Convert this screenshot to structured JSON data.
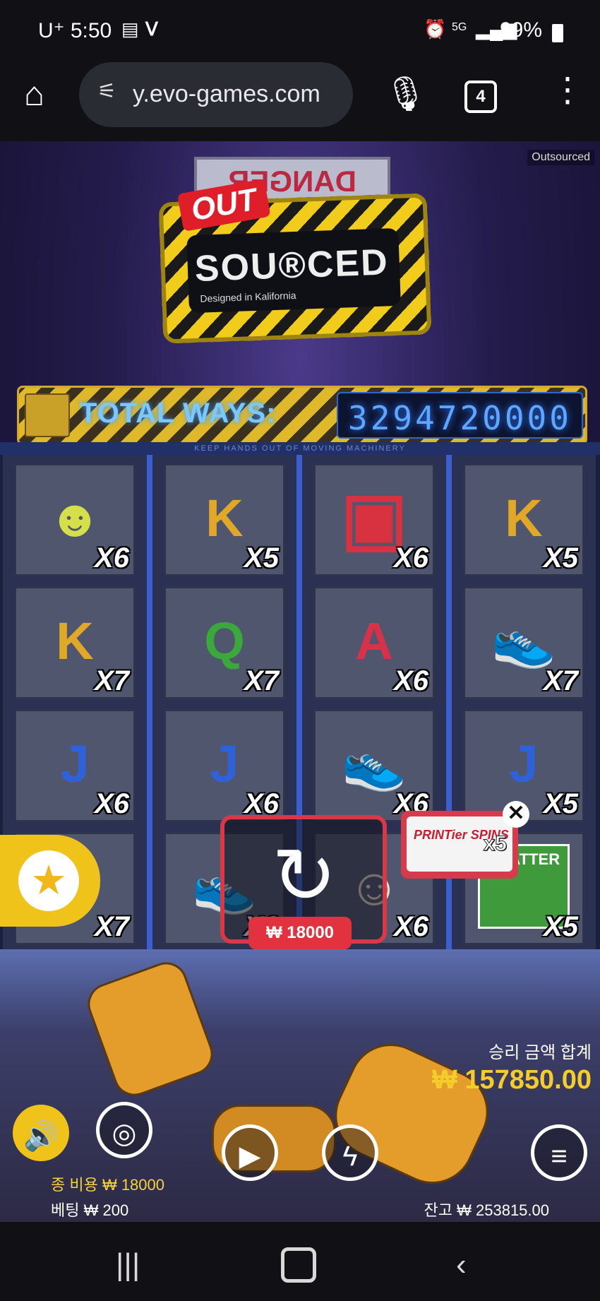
{
  "status_bar": {
    "time": "U⁺ 5:50",
    "network": "5G",
    "battery": "99%"
  },
  "browser": {
    "url": "y.evo-games.com",
    "tab_count": "4"
  },
  "game": {
    "corner_tag": "Outsourced",
    "background_sign": "DANGER",
    "logo": {
      "line1": "OUT",
      "line2": "SOU®CED",
      "tagline": "Designed in Kalifornia"
    },
    "ways": {
      "label": "TOTAL WAYS:",
      "value": "3294720000"
    },
    "warning_strip": "KEEP HANDS OUT OF MOVING MACHINERY",
    "reels": [
      [
        {
          "symbol": "pikachu-mask",
          "glyph": "☻",
          "color": "#d5df4a",
          "mult": "X6"
        },
        {
          "symbol": "K",
          "glyph": "K",
          "color": "#e0a826",
          "mult": "X7"
        },
        {
          "symbol": "J",
          "glyph": "J",
          "color": "#2f62d8",
          "mult": "X6"
        },
        {
          "symbol": "hand",
          "glyph": "✋",
          "color": "#e7c49a",
          "mult": "X7"
        }
      ],
      [
        {
          "symbol": "K",
          "glyph": "K",
          "color": "#e0a826",
          "mult": "X5"
        },
        {
          "symbol": "Q",
          "glyph": "Q",
          "color": "#3aa83a",
          "mult": "X7"
        },
        {
          "symbol": "J",
          "glyph": "J",
          "color": "#2f62d8",
          "mult": "X6"
        },
        {
          "symbol": "sneaker",
          "glyph": "👟",
          "color": "#8a3ae0",
          "mult": "X6"
        }
      ],
      [
        {
          "symbol": "gameboy",
          "glyph": "▣",
          "color": "#d8313f",
          "mult": "X6"
        },
        {
          "symbol": "A",
          "glyph": "A",
          "color": "#d8314a",
          "mult": "X6"
        },
        {
          "symbol": "sneaker",
          "glyph": "👟",
          "color": "#8a3ae0",
          "mult": "X6"
        },
        {
          "symbol": "doll-head",
          "glyph": "☺",
          "color": "#e8d9c4",
          "mult": "X6"
        }
      ],
      [
        {
          "symbol": "K",
          "glyph": "K",
          "color": "#e0a826",
          "mult": "X5"
        },
        {
          "symbol": "sneaker",
          "glyph": "👟",
          "color": "#8a3ae0",
          "mult": "X7"
        },
        {
          "symbol": "J",
          "glyph": "J",
          "color": "#2f62d8",
          "mult": "X5"
        },
        {
          "symbol": "scatter",
          "glyph": "SCATTER",
          "color": "#3f9a3c",
          "mult": "X5"
        }
      ]
    ],
    "spin_cost": "₩ 18000",
    "bonus_badge": {
      "text": "PRINTier SPINS",
      "mult": "x5"
    },
    "win_total_label": "승리 금액 합계",
    "win_total_value": "₩ 157850.00",
    "total_cost": "종 비용  ₩ 18000",
    "bet": "베팅  ₩ 200",
    "balance": "잔고  ₩ 253815.00"
  }
}
